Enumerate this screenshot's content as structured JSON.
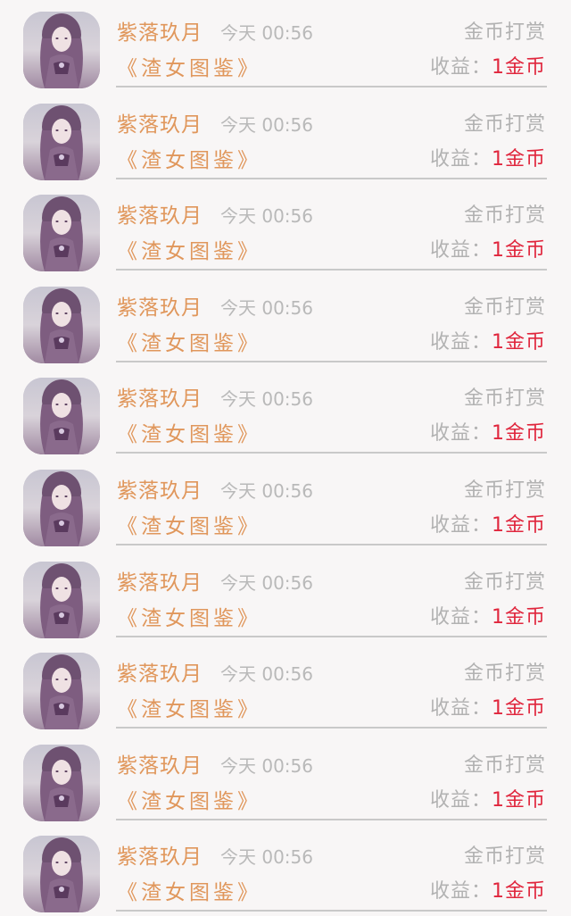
{
  "entries": [
    {
      "name": "紫落玖月",
      "time": "今天 00:56",
      "tip_label": "金币打赏",
      "book": "《渣女图鉴》",
      "income_label": "收益：",
      "income_value": "1金币"
    },
    {
      "name": "紫落玖月",
      "time": "今天 00:56",
      "tip_label": "金币打赏",
      "book": "《渣女图鉴》",
      "income_label": "收益：",
      "income_value": "1金币"
    },
    {
      "name": "紫落玖月",
      "time": "今天 00:56",
      "tip_label": "金币打赏",
      "book": "《渣女图鉴》",
      "income_label": "收益：",
      "income_value": "1金币"
    },
    {
      "name": "紫落玖月",
      "time": "今天 00:56",
      "tip_label": "金币打赏",
      "book": "《渣女图鉴》",
      "income_label": "收益：",
      "income_value": "1金币"
    },
    {
      "name": "紫落玖月",
      "time": "今天 00:56",
      "tip_label": "金币打赏",
      "book": "《渣女图鉴》",
      "income_label": "收益：",
      "income_value": "1金币"
    },
    {
      "name": "紫落玖月",
      "time": "今天 00:56",
      "tip_label": "金币打赏",
      "book": "《渣女图鉴》",
      "income_label": "收益：",
      "income_value": "1金币"
    },
    {
      "name": "紫落玖月",
      "time": "今天 00:56",
      "tip_label": "金币打赏",
      "book": "《渣女图鉴》",
      "income_label": "收益：",
      "income_value": "1金币"
    },
    {
      "name": "紫落玖月",
      "time": "今天 00:56",
      "tip_label": "金币打赏",
      "book": "《渣女图鉴》",
      "income_label": "收益：",
      "income_value": "1金币"
    },
    {
      "name": "紫落玖月",
      "time": "今天 00:56",
      "tip_label": "金币打赏",
      "book": "《渣女图鉴》",
      "income_label": "收益：",
      "income_value": "1金币"
    },
    {
      "name": "紫落玖月",
      "time": "今天 00:56",
      "tip_label": "金币打赏",
      "book": "《渣女图鉴》",
      "income_label": "收益：",
      "income_value": "1金币"
    }
  ],
  "colors": {
    "name_accent": "#e0975c",
    "income_value": "#e0263d",
    "secondary_text": "#b2b2b2",
    "background": "#f8f6f6"
  },
  "icons": {
    "avatar": "avatar-portrait-icon"
  }
}
